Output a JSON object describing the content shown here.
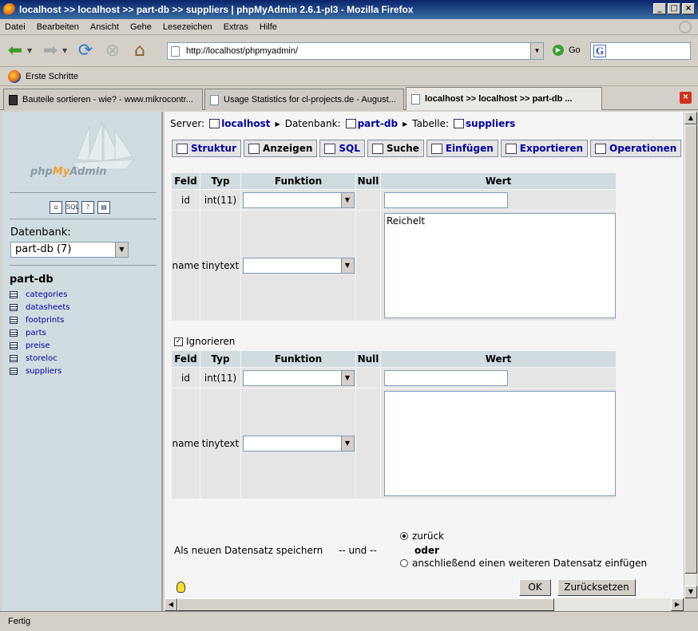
{
  "window": {
    "title": "localhost >> localhost >> part-db  >> suppliers | phpMyAdmin 2.6.1-pl3 - Mozilla Firefox"
  },
  "menu": [
    "Datei",
    "Bearbeiten",
    "Ansicht",
    "Gehe",
    "Lesezeichen",
    "Extras",
    "Hilfe"
  ],
  "toolbar": {
    "url": "http://localhost/phpmyadmin/",
    "go_label": "Go",
    "search_value": ""
  },
  "bookmarks": {
    "first": "Erste Schritte"
  },
  "tabs": [
    {
      "label": "Bauteile sortieren - wie? - www.mikrocontr..."
    },
    {
      "label": "Usage Statistics for cl-projects.de - August..."
    },
    {
      "label": "localhost >> localhost >> part-db ..."
    }
  ],
  "left": {
    "logo_php": "php",
    "logo_my": "My",
    "logo_admin": "Admin",
    "icons": [
      "home-icon",
      "sql-icon",
      "help-icon",
      "docs-icon"
    ],
    "db_label": "Datenbank:",
    "db_select": "part-db (7)",
    "db_name": "part-db",
    "tables": [
      "categories",
      "datasheets",
      "footprints",
      "parts",
      "preise",
      "storeloc",
      "suppliers"
    ]
  },
  "main": {
    "crumb": {
      "server_label": "Server:",
      "server": "localhost",
      "db_label": "Datenbank:",
      "db": "part-db",
      "table_label": "Tabelle:",
      "table": "suppliers"
    },
    "tabs": [
      "Struktur",
      "Anzeigen",
      "SQL",
      "Suche",
      "Einfügen",
      "Exportieren",
      "Operationen"
    ],
    "headers": {
      "feld": "Feld",
      "typ": "Typ",
      "funktion": "Funktion",
      "null": "Null",
      "wert": "Wert"
    },
    "rows1": [
      {
        "feld": "id",
        "typ": "int(11)",
        "value": ""
      },
      {
        "feld": "name",
        "typ": "tinytext",
        "value": "Reichelt"
      }
    ],
    "ignore_label": "Ignorieren",
    "rows2": [
      {
        "feld": "id",
        "typ": "int(11)",
        "value": ""
      },
      {
        "feld": "name",
        "typ": "tinytext",
        "value": ""
      }
    ],
    "save_as": "Als neuen Datensatz speichern",
    "und": "-- und --",
    "radio_back": "zurück",
    "oder": "oder",
    "radio_next": "anschließend einen weiteren Datensatz einfügen",
    "ok": "OK",
    "reset": "Zurücksetzen"
  },
  "status": {
    "text": "Fertig"
  }
}
